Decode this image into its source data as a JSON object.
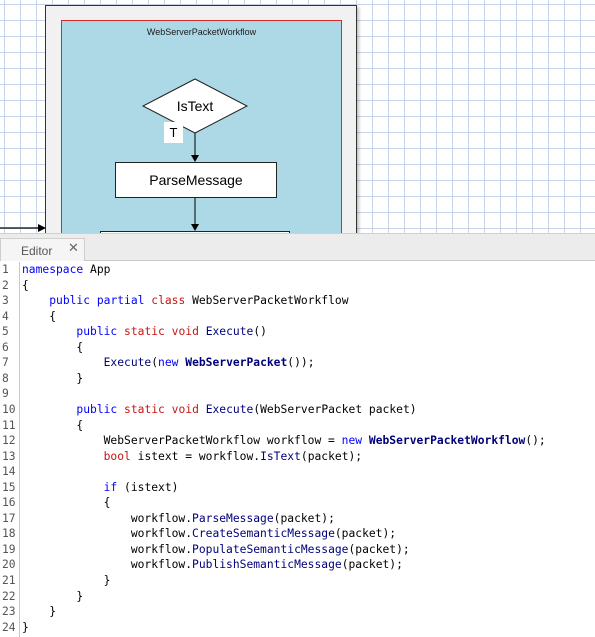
{
  "canvas": {
    "workflow_title": "WebServerPacketWorkflow",
    "decision_label": "IsText",
    "branch_label": "T",
    "process_label": "ParseMessage"
  },
  "editor": {
    "tab_label": "Editor",
    "close_glyph": "✕",
    "code_lines": [
      {
        "n": "1",
        "tokens": [
          {
            "t": "namespace",
            "c": "kw"
          },
          {
            "t": " App",
            "c": "plain"
          }
        ]
      },
      {
        "n": "2",
        "tokens": [
          {
            "t": "{",
            "c": "plain"
          }
        ]
      },
      {
        "n": "3",
        "tokens": [
          {
            "t": "    ",
            "c": "plain"
          },
          {
            "t": "public",
            "c": "kw"
          },
          {
            "t": " ",
            "c": "plain"
          },
          {
            "t": "partial",
            "c": "kw"
          },
          {
            "t": " ",
            "c": "plain"
          },
          {
            "t": "class",
            "c": "kw2"
          },
          {
            "t": " WebServerPacketWorkflow",
            "c": "plain"
          }
        ]
      },
      {
        "n": "4",
        "tokens": [
          {
            "t": "    {",
            "c": "plain"
          }
        ]
      },
      {
        "n": "5",
        "tokens": [
          {
            "t": "        ",
            "c": "plain"
          },
          {
            "t": "public",
            "c": "kw"
          },
          {
            "t": " ",
            "c": "plain"
          },
          {
            "t": "static",
            "c": "kw2"
          },
          {
            "t": " ",
            "c": "plain"
          },
          {
            "t": "void",
            "c": "kw2"
          },
          {
            "t": " ",
            "c": "plain"
          },
          {
            "t": "Execute",
            "c": "method"
          },
          {
            "t": "()",
            "c": "plain"
          }
        ]
      },
      {
        "n": "6",
        "tokens": [
          {
            "t": "        {",
            "c": "plain"
          }
        ]
      },
      {
        "n": "7",
        "tokens": [
          {
            "t": "            ",
            "c": "plain"
          },
          {
            "t": "Execute",
            "c": "method"
          },
          {
            "t": "(",
            "c": "plain"
          },
          {
            "t": "new",
            "c": "kw"
          },
          {
            "t": " ",
            "c": "plain"
          },
          {
            "t": "WebServerPacket",
            "c": "type"
          },
          {
            "t": "());",
            "c": "plain"
          }
        ]
      },
      {
        "n": "8",
        "tokens": [
          {
            "t": "        }",
            "c": "plain"
          }
        ]
      },
      {
        "n": "9",
        "tokens": [
          {
            "t": "",
            "c": "plain"
          }
        ]
      },
      {
        "n": "10",
        "tokens": [
          {
            "t": "        ",
            "c": "plain"
          },
          {
            "t": "public",
            "c": "kw"
          },
          {
            "t": " ",
            "c": "plain"
          },
          {
            "t": "static",
            "c": "kw2"
          },
          {
            "t": " ",
            "c": "plain"
          },
          {
            "t": "void",
            "c": "kw2"
          },
          {
            "t": " ",
            "c": "plain"
          },
          {
            "t": "Execute",
            "c": "method"
          },
          {
            "t": "(WebServerPacket packet)",
            "c": "plain"
          }
        ]
      },
      {
        "n": "11",
        "tokens": [
          {
            "t": "        {",
            "c": "plain"
          }
        ]
      },
      {
        "n": "12",
        "tokens": [
          {
            "t": "            WebServerPacketWorkflow workflow = ",
            "c": "plain"
          },
          {
            "t": "new",
            "c": "kw"
          },
          {
            "t": " ",
            "c": "plain"
          },
          {
            "t": "WebServerPacketWorkflow",
            "c": "type"
          },
          {
            "t": "();",
            "c": "plain"
          }
        ]
      },
      {
        "n": "13",
        "tokens": [
          {
            "t": "            ",
            "c": "plain"
          },
          {
            "t": "bool",
            "c": "kw2"
          },
          {
            "t": " istext = workflow.",
            "c": "plain"
          },
          {
            "t": "IsText",
            "c": "method"
          },
          {
            "t": "(packet);",
            "c": "plain"
          }
        ]
      },
      {
        "n": "14",
        "tokens": [
          {
            "t": "",
            "c": "plain"
          }
        ]
      },
      {
        "n": "15",
        "tokens": [
          {
            "t": "            ",
            "c": "plain"
          },
          {
            "t": "if",
            "c": "kw"
          },
          {
            "t": " (istext)",
            "c": "plain"
          }
        ]
      },
      {
        "n": "16",
        "tokens": [
          {
            "t": "            {",
            "c": "plain"
          }
        ]
      },
      {
        "n": "17",
        "tokens": [
          {
            "t": "                workflow.",
            "c": "plain"
          },
          {
            "t": "ParseMessage",
            "c": "method"
          },
          {
            "t": "(packet);",
            "c": "plain"
          }
        ]
      },
      {
        "n": "18",
        "tokens": [
          {
            "t": "                workflow.",
            "c": "plain"
          },
          {
            "t": "CreateSemanticMessage",
            "c": "method"
          },
          {
            "t": "(packet);",
            "c": "plain"
          }
        ]
      },
      {
        "n": "19",
        "tokens": [
          {
            "t": "                workflow.",
            "c": "plain"
          },
          {
            "t": "PopulateSemanticMessage",
            "c": "method"
          },
          {
            "t": "(packet);",
            "c": "plain"
          }
        ]
      },
      {
        "n": "20",
        "tokens": [
          {
            "t": "                workflow.",
            "c": "plain"
          },
          {
            "t": "PublishSemanticMessage",
            "c": "method"
          },
          {
            "t": "(packet);",
            "c": "plain"
          }
        ]
      },
      {
        "n": "21",
        "tokens": [
          {
            "t": "            }",
            "c": "plain"
          }
        ]
      },
      {
        "n": "22",
        "tokens": [
          {
            "t": "        }",
            "c": "plain"
          }
        ]
      },
      {
        "n": "23",
        "tokens": [
          {
            "t": "    }",
            "c": "plain"
          }
        ]
      },
      {
        "n": "24",
        "tokens": [
          {
            "t": "}",
            "c": "plain"
          }
        ]
      }
    ]
  },
  "colors": {
    "canvas_grid": "#c9d3e6",
    "workflow_fill": "#add8e6",
    "workflow_border": "#d42a2a",
    "keyword": "#0000ff",
    "keyword_alt": "#c81414",
    "type_name": "#00007a"
  }
}
